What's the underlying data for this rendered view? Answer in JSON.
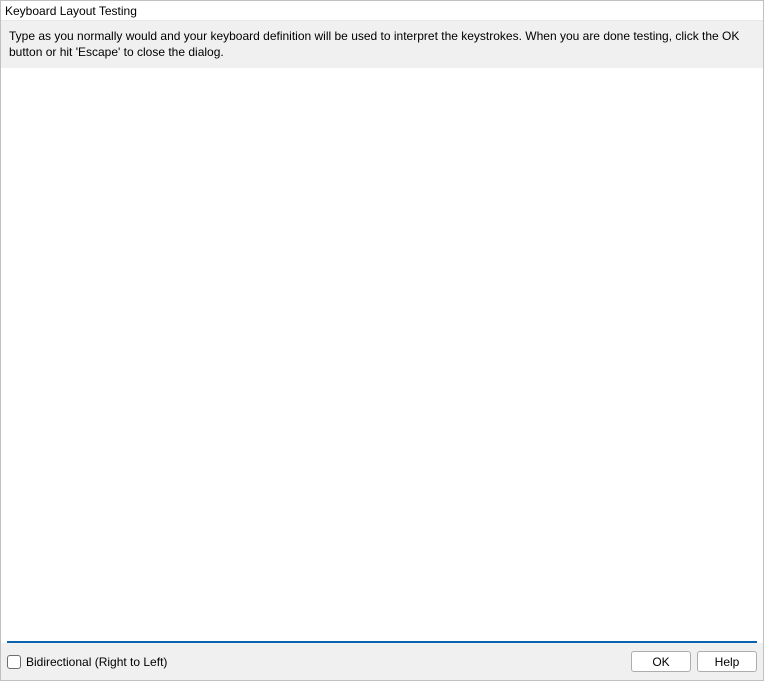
{
  "dialog": {
    "title": "Keyboard Layout Testing",
    "instructions": "Type as you normally would and your keyboard definition will be used to interpret the keystrokes. When you are done testing, click the OK button or hit 'Escape' to close the dialog.",
    "textarea_value": "",
    "textarea_placeholder": ""
  },
  "footer": {
    "checkbox_label": "Bidirectional (Right to Left)",
    "checkbox_checked": false,
    "ok_label": "OK",
    "help_label": "Help"
  }
}
